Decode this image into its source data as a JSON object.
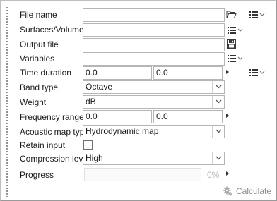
{
  "fields": {
    "file_name": {
      "label": "File name",
      "value": ""
    },
    "surfaces_volumes": {
      "label": "Surfaces/Volumes",
      "value": ""
    },
    "output_file": {
      "label": "Output file",
      "value": ""
    },
    "variables": {
      "label": "Variables",
      "value": ""
    },
    "time_duration": {
      "label": "Time duration",
      "start": "0.0",
      "end": "0.0"
    },
    "band_type": {
      "label": "Band type",
      "selected": "Octave"
    },
    "weight": {
      "label": "Weight",
      "selected": "dB"
    },
    "frequency_range": {
      "label": "Frequency range",
      "start": "0.0",
      "end": "0.0"
    },
    "acoustic_map_type": {
      "label": "Acoustic map type",
      "selected": "Hydrodynamic map"
    },
    "retain_input": {
      "label": "Retain input",
      "checked": false
    },
    "compression_level": {
      "label": "Compression level",
      "selected": "High"
    },
    "progress": {
      "label": "Progress",
      "percent_text": "0%",
      "value": 0
    }
  },
  "actions": {
    "calculate_label": "Calculate"
  },
  "icons": {
    "open_folder": "open-folder-icon",
    "save": "save-icon",
    "list_menu": "list-menu-icon",
    "expand_arrow": "expand-arrow-icon",
    "dropdown": "chevron-down-icon",
    "calculate": "gear-icon"
  },
  "colors": {
    "border": "#b5b5b5",
    "disabled_text": "#8a8a8a",
    "text": "#1a1a1a"
  }
}
